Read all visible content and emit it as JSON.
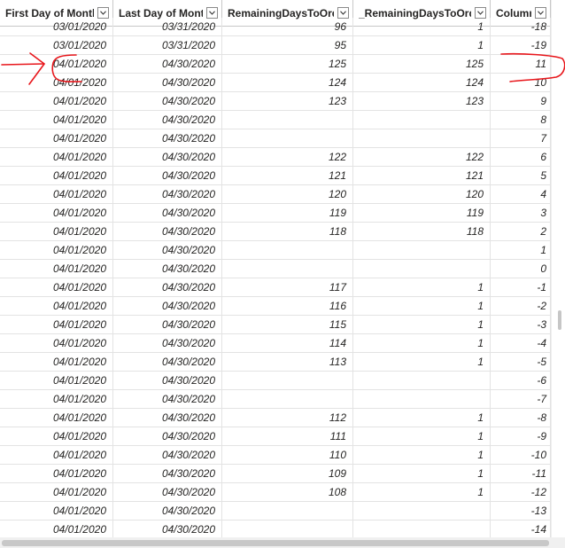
{
  "table": {
    "headers": [
      "First Day of Month",
      "Last Day of Month",
      "RemainingDaysToOrder",
      "_RemainingDaysToOrder",
      "Column"
    ],
    "rows": [
      [
        "03/01/2020",
        "03/31/2020",
        "96",
        "1",
        "-18"
      ],
      [
        "03/01/2020",
        "03/31/2020",
        "95",
        "1",
        "-19"
      ],
      [
        "04/01/2020",
        "04/30/2020",
        "125",
        "125",
        "11"
      ],
      [
        "04/01/2020",
        "04/30/2020",
        "124",
        "124",
        "10"
      ],
      [
        "04/01/2020",
        "04/30/2020",
        "123",
        "123",
        "9"
      ],
      [
        "04/01/2020",
        "04/30/2020",
        "",
        "",
        "8"
      ],
      [
        "04/01/2020",
        "04/30/2020",
        "",
        "",
        "7"
      ],
      [
        "04/01/2020",
        "04/30/2020",
        "122",
        "122",
        "6"
      ],
      [
        "04/01/2020",
        "04/30/2020",
        "121",
        "121",
        "5"
      ],
      [
        "04/01/2020",
        "04/30/2020",
        "120",
        "120",
        "4"
      ],
      [
        "04/01/2020",
        "04/30/2020",
        "119",
        "119",
        "3"
      ],
      [
        "04/01/2020",
        "04/30/2020",
        "118",
        "118",
        "2"
      ],
      [
        "04/01/2020",
        "04/30/2020",
        "",
        "",
        "1"
      ],
      [
        "04/01/2020",
        "04/30/2020",
        "",
        "",
        "0"
      ],
      [
        "04/01/2020",
        "04/30/2020",
        "117",
        "1",
        "-1"
      ],
      [
        "04/01/2020",
        "04/30/2020",
        "116",
        "1",
        "-2"
      ],
      [
        "04/01/2020",
        "04/30/2020",
        "115",
        "1",
        "-3"
      ],
      [
        "04/01/2020",
        "04/30/2020",
        "114",
        "1",
        "-4"
      ],
      [
        "04/01/2020",
        "04/30/2020",
        "113",
        "1",
        "-5"
      ],
      [
        "04/01/2020",
        "04/30/2020",
        "",
        "",
        "-6"
      ],
      [
        "04/01/2020",
        "04/30/2020",
        "",
        "",
        "-7"
      ],
      [
        "04/01/2020",
        "04/30/2020",
        "112",
        "1",
        "-8"
      ],
      [
        "04/01/2020",
        "04/30/2020",
        "111",
        "1",
        "-9"
      ],
      [
        "04/01/2020",
        "04/30/2020",
        "110",
        "1",
        "-10"
      ],
      [
        "04/01/2020",
        "04/30/2020",
        "109",
        "1",
        "-11"
      ],
      [
        "04/01/2020",
        "04/30/2020",
        "108",
        "1",
        "-12"
      ],
      [
        "04/01/2020",
        "04/30/2020",
        "",
        "",
        "-13"
      ],
      [
        "04/01/2020",
        "04/30/2020",
        "",
        "",
        "-14"
      ]
    ]
  },
  "icons": {
    "column_filter": "chevron-down-icon",
    "annotation": "red-arrow-and-circle-marks"
  },
  "colors": {
    "annotation_red": "#e8161b",
    "gridline": "#e3e3e3",
    "header_border": "#c8c8c8",
    "text": "#252423"
  }
}
